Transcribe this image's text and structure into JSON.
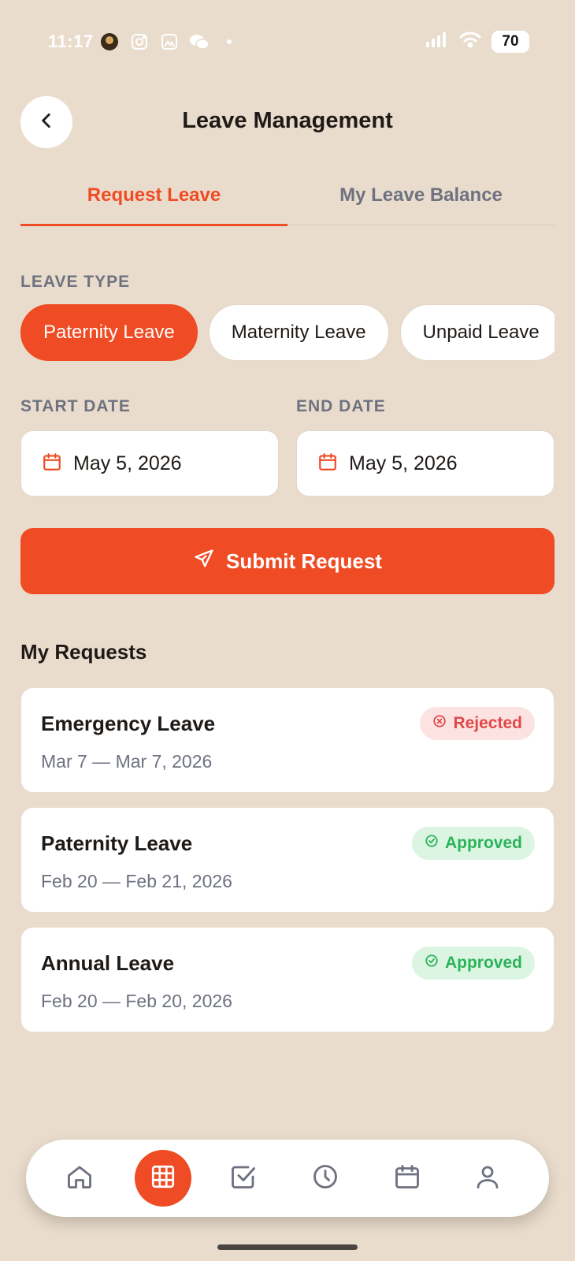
{
  "status_bar": {
    "time": "11:17",
    "battery": "70"
  },
  "header": {
    "title": "Leave Management"
  },
  "tabs": [
    {
      "label": "Request Leave",
      "active": true
    },
    {
      "label": "My Leave Balance",
      "active": false
    }
  ],
  "leave_type": {
    "label": "LEAVE TYPE",
    "options": [
      {
        "label": "Paternity Leave",
        "selected": true
      },
      {
        "label": "Maternity Leave",
        "selected": false
      },
      {
        "label": "Unpaid Leave",
        "selected": false
      }
    ]
  },
  "start_date": {
    "label": "START DATE",
    "value": "May 5, 2026"
  },
  "end_date": {
    "label": "END DATE",
    "value": "May 5, 2026"
  },
  "submit": {
    "label": "Submit Request"
  },
  "requests": {
    "title": "My Requests",
    "items": [
      {
        "name": "Emergency Leave",
        "dates": "Mar 7 — Mar 7, 2026",
        "status": "Rejected"
      },
      {
        "name": "Paternity Leave",
        "dates": "Feb 20 — Feb 21, 2026",
        "status": "Approved"
      },
      {
        "name": "Annual Leave",
        "dates": "Feb 20 — Feb 20, 2026",
        "status": "Approved"
      }
    ]
  },
  "bottom_nav": [
    {
      "icon": "home-icon",
      "active": false
    },
    {
      "icon": "grid-icon",
      "active": true
    },
    {
      "icon": "checkbox-icon",
      "active": false
    },
    {
      "icon": "clock-icon",
      "active": false
    },
    {
      "icon": "calendar-icon",
      "active": false
    },
    {
      "icon": "user-icon",
      "active": false
    }
  ],
  "colors": {
    "accent": "#ef4b24",
    "background": "#e9dccc",
    "rejected": "#e04848",
    "approved": "#2bb35a"
  }
}
